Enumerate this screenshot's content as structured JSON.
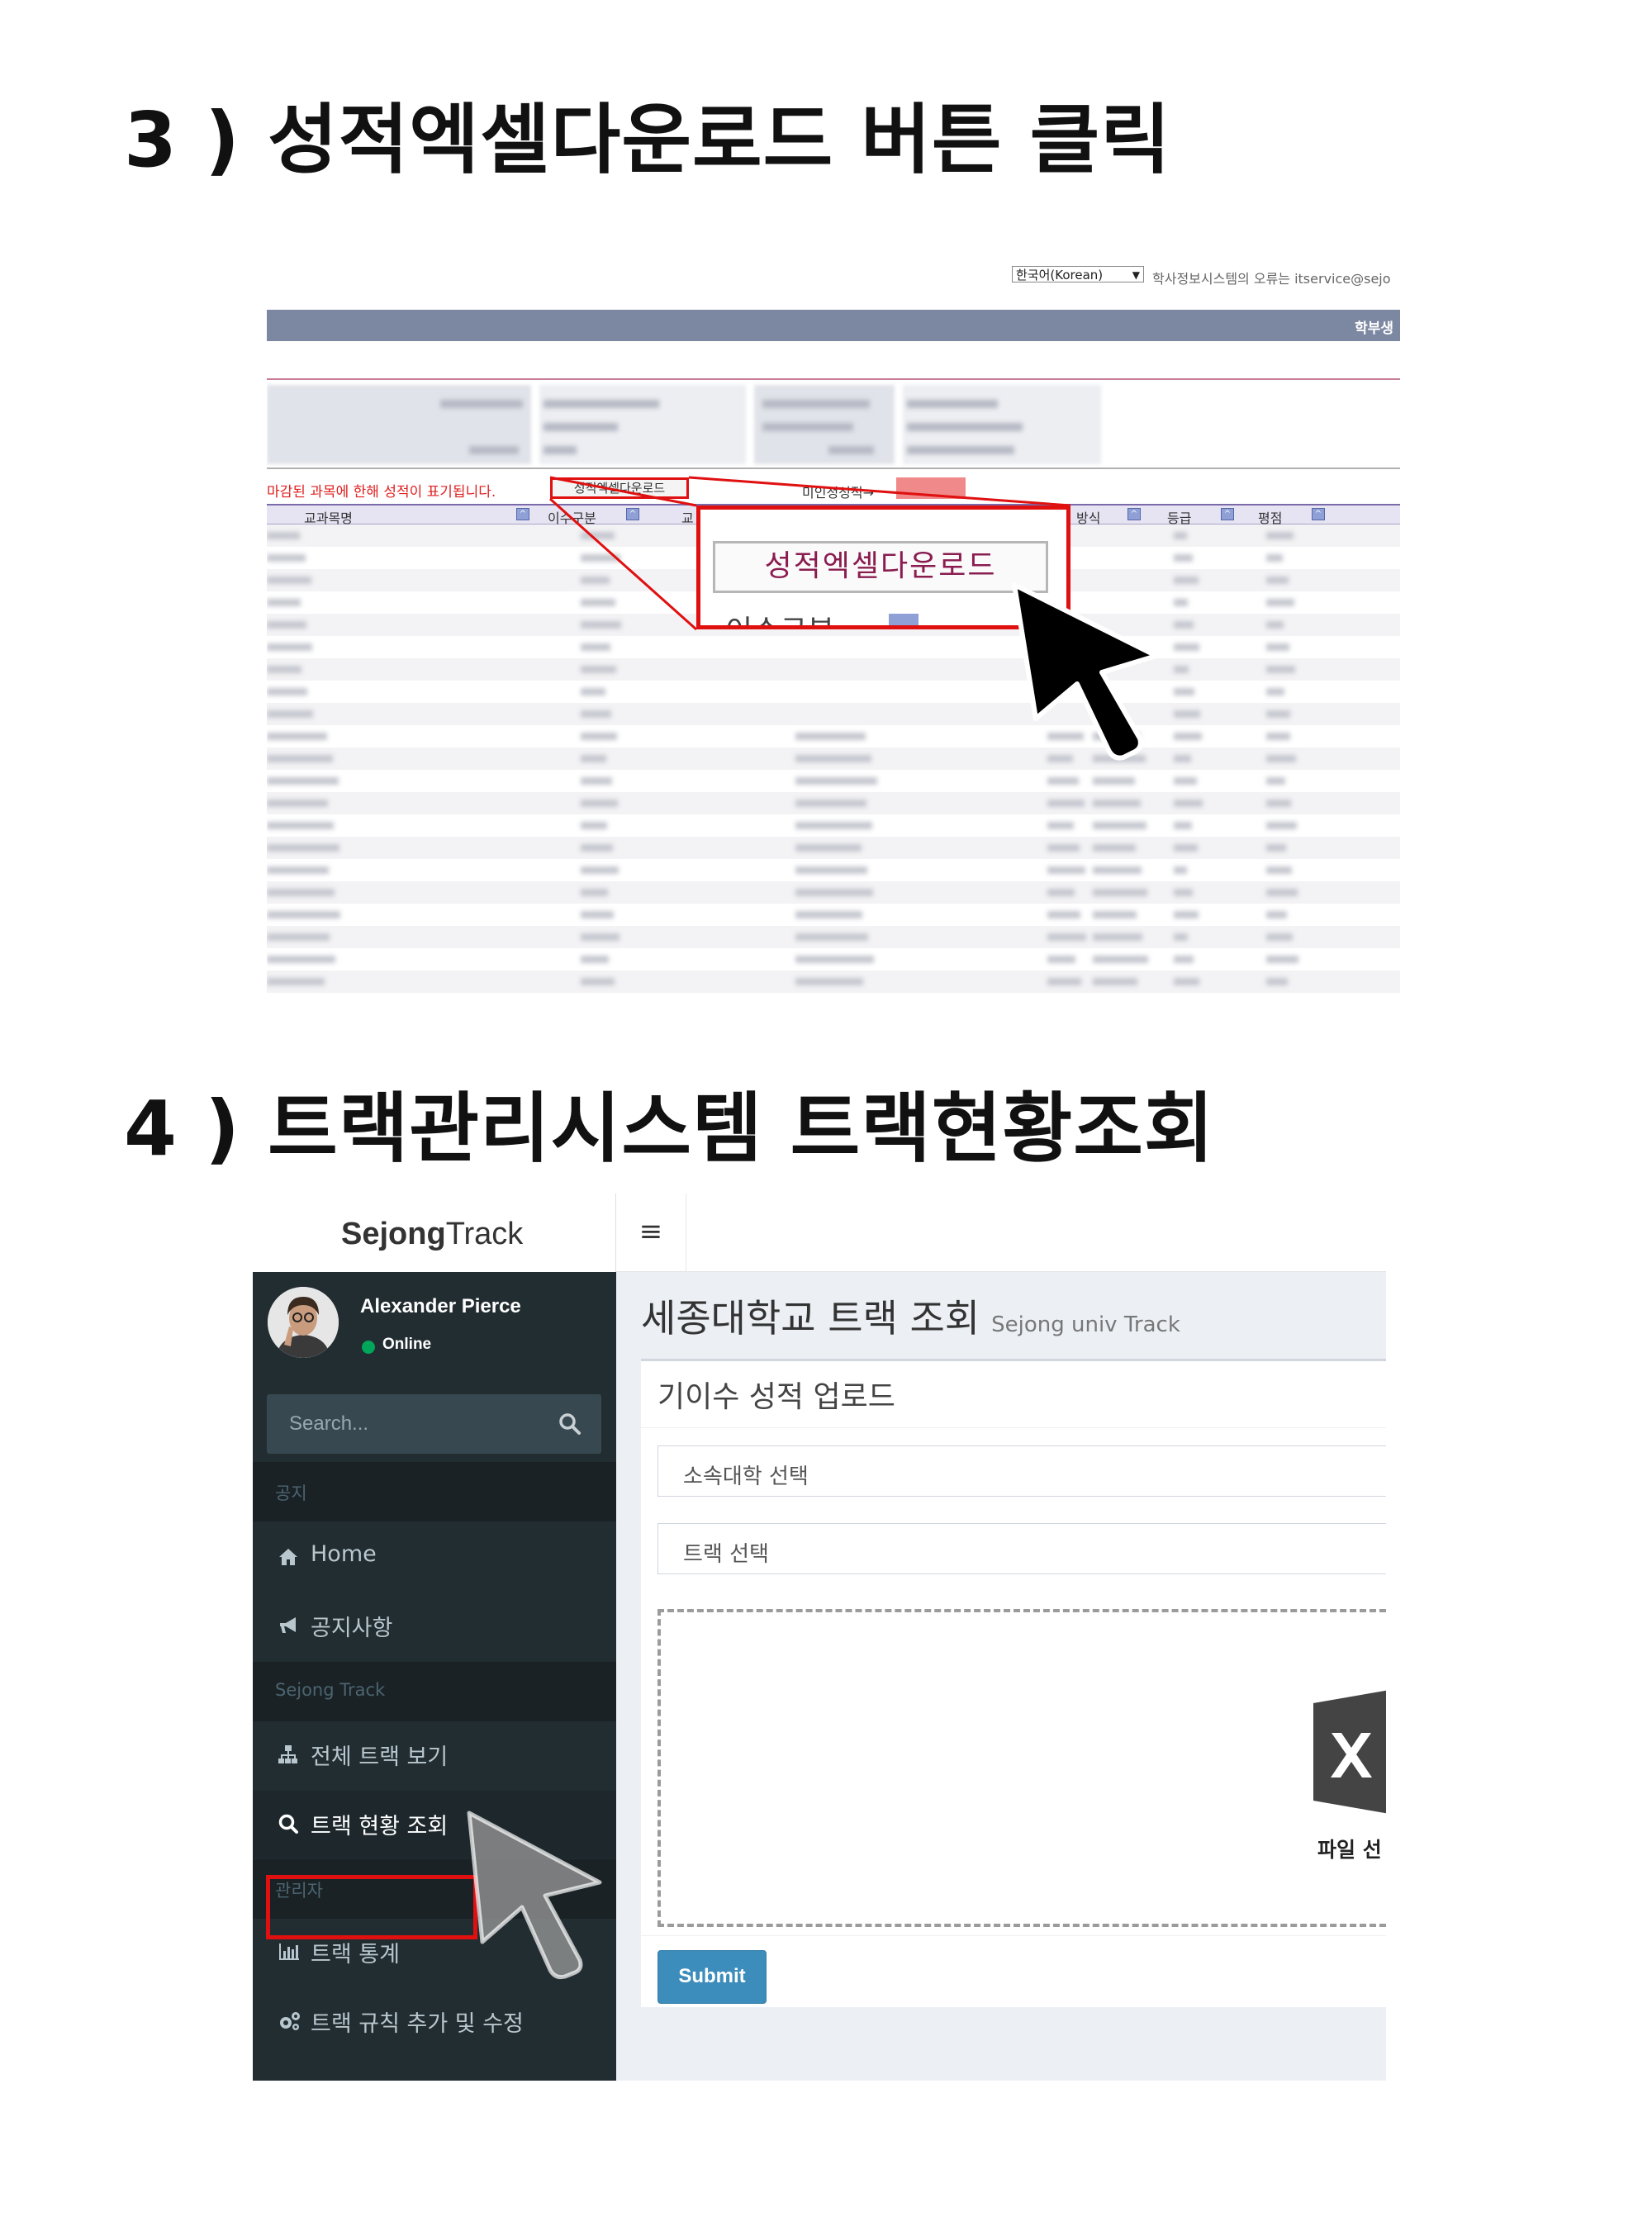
{
  "step3": {
    "heading": "3 ) 성적엑셀다운로드 버튼 클릭",
    "lang_select": "한국어(Korean)",
    "lang_arrow": "▼",
    "notice": "학사정보시스템의 오류는 itservice@sejo",
    "topbar_label": "학부생",
    "red_note": "마감된 과목에 한해 성적이 표기됩니다.",
    "excel_button_small": "성적엑셀다운로드",
    "retake_label": "미인정성적→",
    "headers": [
      "교과목명",
      "이수구분",
      "교",
      "방식",
      "등급",
      "평점"
    ],
    "excel_button_zoom": "성적엑셀다운로드",
    "zoom_partial_text": "이수구분"
  },
  "step4": {
    "heading": "4 ) 트랙관리시스템 트랙현황조회",
    "logo_bold": "Sejong",
    "logo_light": "Track",
    "menu_toggle": "≡",
    "user": {
      "name": "Alexander Pierce",
      "status": "Online"
    },
    "search_placeholder": "Search...",
    "sections": {
      "notice": "공지",
      "track": "Sejong Track",
      "admin": "관리자"
    },
    "menu": {
      "home": "Home",
      "notices": "공지사항",
      "all_tracks": "전체 트랙 보기",
      "track_status": "트랙 현황 조회",
      "track_stats": "트랙 통계",
      "track_rules": "트랙 규칙 추가 및 수정"
    },
    "page_title": "세종대학교 트랙 조회",
    "page_subtitle": "Sejong univ Track",
    "box_title": "기이수 성적 업로드",
    "college_select": "소속대학 선택",
    "track_select": "트랙 선택",
    "file_label": "파일 선",
    "submit_label": "Submit",
    "colors": {
      "sidebar": "#222d32",
      "accent": "#3c8dbc",
      "online": "#00a65a",
      "highlight": "#e01010"
    },
    "icons": [
      "search-icon",
      "home-icon",
      "bullhorn-icon",
      "sitemap-icon",
      "search-icon",
      "bar-chart-icon",
      "cogs-icon",
      "excel-file-icon",
      "cursor-arrow-icon"
    ]
  }
}
